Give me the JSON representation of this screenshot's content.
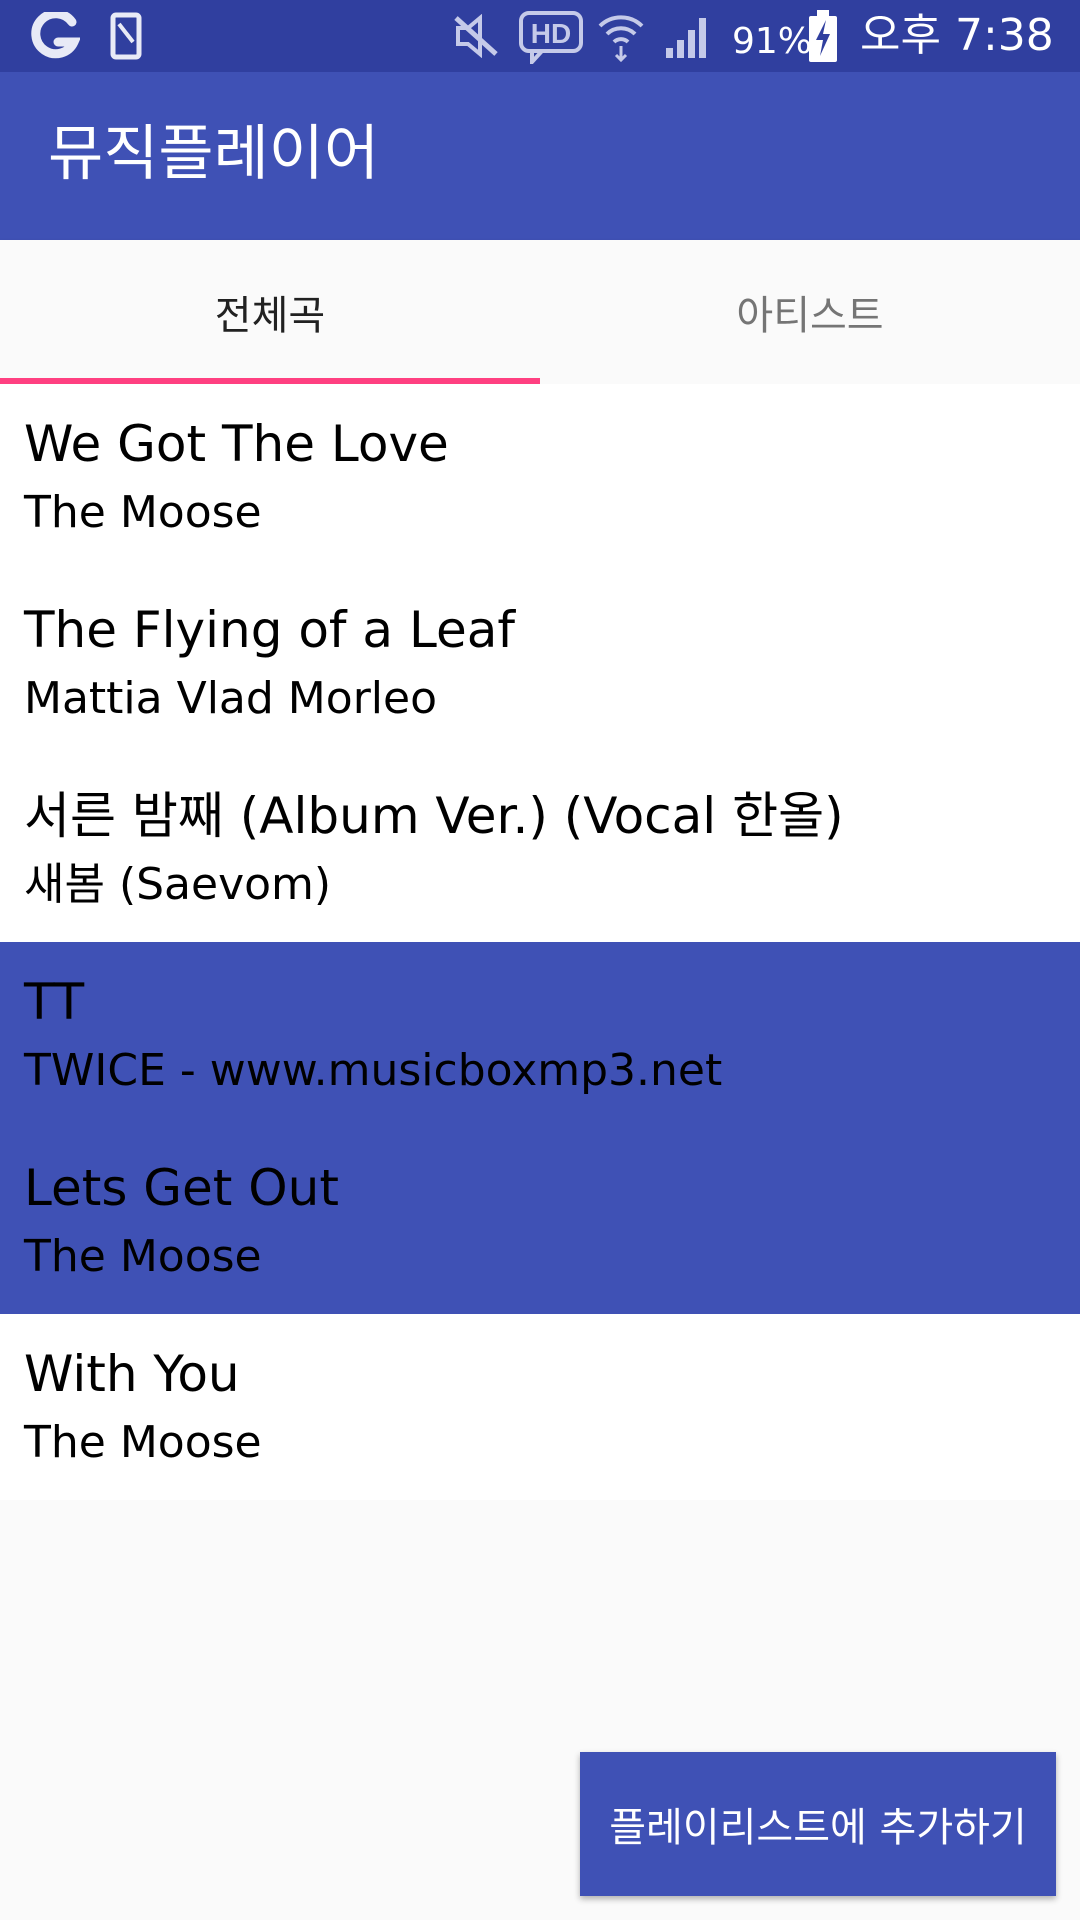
{
  "status_bar": {
    "battery": "91%",
    "time": "오후 7:38",
    "icons": [
      "g-icon",
      "phone-icon",
      "mute-icon",
      "hd-icon",
      "wifi-icon",
      "signal-icon",
      "battery-charging-icon"
    ]
  },
  "app_bar": {
    "title": "뮤직플레이어"
  },
  "tabs": [
    {
      "label": "전체곡",
      "selected": true
    },
    {
      "label": "아티스트",
      "selected": false
    }
  ],
  "songs": [
    {
      "title": "We Got The Love",
      "artist": "The Moose",
      "selected": false
    },
    {
      "title": "The Flying of a Leaf",
      "artist": "Mattia Vlad Morleo",
      "selected": false
    },
    {
      "title": "서른 밤째 (Album Ver.) (Vocal 한올)",
      "artist": "새봄 (Saevom)",
      "selected": false
    },
    {
      "title": "TT",
      "artist": "TWICE - www.musicboxmp3.net",
      "selected": true
    },
    {
      "title": "Lets Get Out",
      "artist": "The Moose",
      "selected": true
    },
    {
      "title": "With You",
      "artist": "The Moose",
      "selected": false
    }
  ],
  "add_to_playlist_button": "플레이리스트에 추가하기",
  "colors": {
    "status_bar": "#303f9f",
    "primary": "#3f51b5",
    "accent": "#ff4081"
  }
}
